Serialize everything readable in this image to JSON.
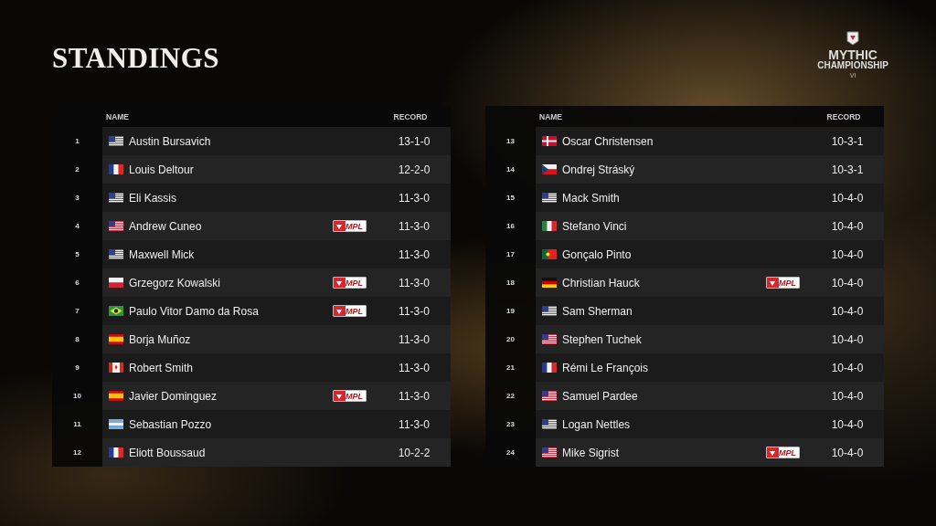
{
  "title": "STANDINGS",
  "logo": {
    "line_1": "MYTHIC",
    "line_2": "CHAMPIONSHIP",
    "edition": "VI"
  },
  "tables": [
    {
      "columns": {
        "name": "NAME",
        "record": "RECORD"
      },
      "rows": [
        {
          "rank": "1",
          "kind": "us",
          "name": "Austin Bursavich",
          "record": "13-1-0"
        },
        {
          "rank": "2",
          "kind": "fr",
          "name": "Louis Deltour",
          "record": "12-2-0"
        },
        {
          "rank": "3",
          "kind": "us",
          "name": "Eli Kassis",
          "record": "11-3-0"
        },
        {
          "rank": "4",
          "kind": "us",
          "name": "Andrew Cuneo",
          "badge": "MPL",
          "record": "11-3-0"
        },
        {
          "rank": "5",
          "kind": "us",
          "name": "Maxwell Mick",
          "record": "11-3-0"
        },
        {
          "rank": "6",
          "kind": "pl",
          "name": "Grzegorz Kowalski",
          "badge": "MPL",
          "record": "11-3-0"
        },
        {
          "rank": "7",
          "kind": "br",
          "name": "Paulo Vitor Damo da Rosa",
          "badge": "MPL",
          "record": "11-3-0"
        },
        {
          "rank": "8",
          "kind": "es",
          "name": "Borja Muñoz",
          "record": "11-3-0"
        },
        {
          "rank": "9",
          "kind": "ca",
          "name": "Robert Smith",
          "record": "11-3-0"
        },
        {
          "rank": "10",
          "kind": "es",
          "name": "Javier Dominguez",
          "badge": "MPL",
          "record": "11-3-0"
        },
        {
          "rank": "11",
          "kind": "ar",
          "name": "Sebastian Pozzo",
          "record": "11-3-0"
        },
        {
          "rank": "12",
          "kind": "fr",
          "name": "Eliott Boussaud",
          "record": "10-2-2"
        }
      ]
    },
    {
      "columns": {
        "name": "NAME",
        "record": "RECORD"
      },
      "rows": [
        {
          "rank": "13",
          "kind": "dk",
          "name": "Oscar Christensen",
          "record": "10-3-1"
        },
        {
          "rank": "14",
          "kind": "cz",
          "name": "Ondrej Stráský",
          "record": "10-3-1"
        },
        {
          "rank": "15",
          "kind": "us",
          "name": "Mack Smith",
          "record": "10-4-0"
        },
        {
          "rank": "16",
          "kind": "it",
          "name": "Stefano Vinci",
          "record": "10-4-0"
        },
        {
          "rank": "17",
          "kind": "pt",
          "name": "Gonçalo Pinto",
          "record": "10-4-0"
        },
        {
          "rank": "18",
          "kind": "de",
          "name": "Christian Hauck",
          "badge": "MPL",
          "record": "10-4-0"
        },
        {
          "rank": "19",
          "kind": "us",
          "name": "Sam Sherman",
          "record": "10-4-0"
        },
        {
          "rank": "20",
          "kind": "us",
          "name": "Stephen Tuchek",
          "record": "10-4-0"
        },
        {
          "rank": "21",
          "kind": "fr",
          "name": "Rémi Le François",
          "record": "10-4-0"
        },
        {
          "rank": "22",
          "kind": "us",
          "name": "Samuel Pardee",
          "record": "10-4-0"
        },
        {
          "rank": "23",
          "kind": "us",
          "name": "Logan Nettles",
          "record": "10-4-0"
        },
        {
          "rank": "24",
          "kind": "us",
          "name": "Mike Sigrist",
          "badge": "MPL",
          "record": "10-4-0"
        }
      ]
    }
  ]
}
